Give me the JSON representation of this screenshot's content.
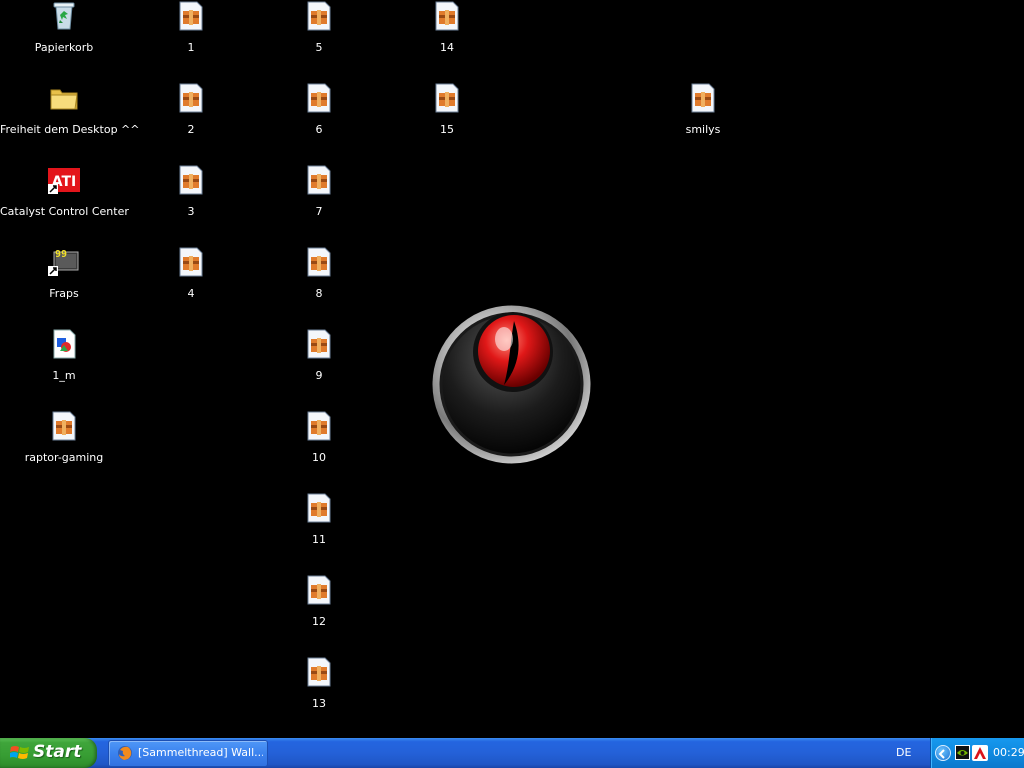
{
  "desktop": {
    "icons": {
      "recycle_bin": {
        "label": "Papierkorb",
        "icon": "recycle-bin-icon"
      },
      "folder": {
        "label": "Freiheit dem Desktop ^^",
        "icon": "folder-icon"
      },
      "catalyst": {
        "label": "Catalyst Control Center",
        "icon": "ati-logo-icon",
        "badge": "ATI"
      },
      "fraps": {
        "label": "Fraps",
        "icon": "fraps-icon",
        "badge": "99"
      },
      "one_m": {
        "label": "1_m",
        "icon": "image-file-icon"
      },
      "raptor_gaming": {
        "label": "raptor-gaming",
        "icon": "archive-file-icon"
      },
      "f1": {
        "label": "1",
        "icon": "archive-file-icon"
      },
      "f2": {
        "label": "2",
        "icon": "archive-file-icon"
      },
      "f3": {
        "label": "3",
        "icon": "archive-file-icon"
      },
      "f4": {
        "label": "4",
        "icon": "archive-file-icon"
      },
      "f5": {
        "label": "5",
        "icon": "archive-file-icon"
      },
      "f6": {
        "label": "6",
        "icon": "archive-file-icon"
      },
      "f7": {
        "label": "7",
        "icon": "archive-file-icon"
      },
      "f8": {
        "label": "8",
        "icon": "archive-file-icon"
      },
      "f9": {
        "label": "9",
        "icon": "archive-file-icon"
      },
      "f10": {
        "label": "10",
        "icon": "archive-file-icon"
      },
      "f11": {
        "label": "11",
        "icon": "archive-file-icon"
      },
      "f12": {
        "label": "12",
        "icon": "archive-file-icon"
      },
      "f13": {
        "label": "13",
        "icon": "archive-file-icon"
      },
      "f14": {
        "label": "14",
        "icon": "archive-file-icon"
      },
      "f15": {
        "label": "15",
        "icon": "archive-file-icon"
      },
      "smilys": {
        "label": "smilys",
        "icon": "archive-file-icon"
      }
    },
    "wallpaper": {
      "logo": "raptor-eye-logo",
      "background": "#000000"
    }
  },
  "taskbar": {
    "start_label": "Start",
    "task_label": "[Sammelthread] Wall...",
    "task_icon": "firefox-icon",
    "language": "DE",
    "clock": "00:29",
    "tray_icons": [
      "tray-collapse-icon",
      "nvidia-icon",
      "antivir-icon"
    ],
    "colors": {
      "taskbar": "#2461d8",
      "start": "#379d33",
      "tray": "#0f8ae0"
    }
  }
}
